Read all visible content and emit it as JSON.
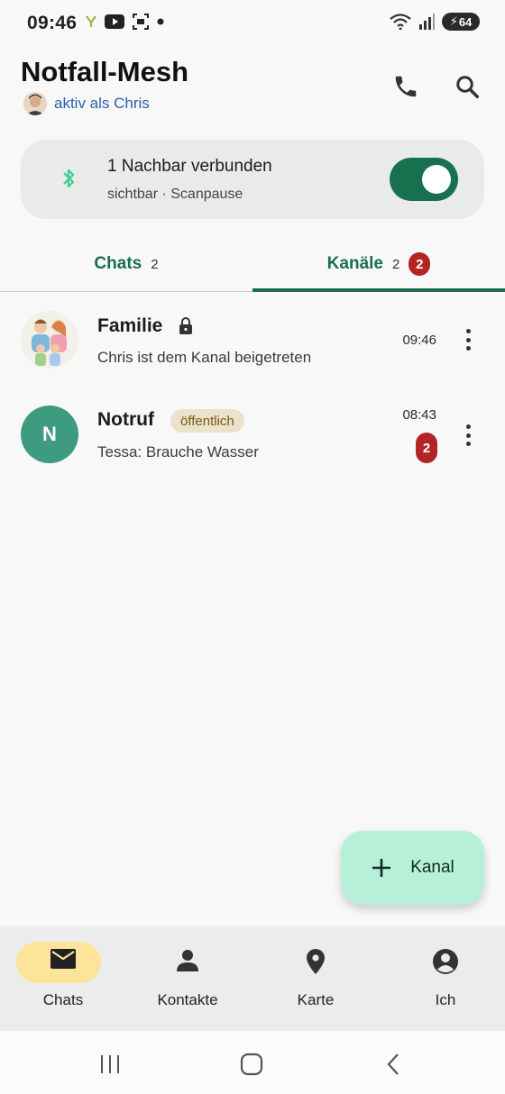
{
  "status_bar": {
    "time": "09:46",
    "battery": "64",
    "icons_left": [
      "vpn-key-icon",
      "youtube-icon",
      "screenshot-icon",
      "dot-icon"
    ],
    "icons_right": [
      "wifi-icon",
      "signal-icon",
      "battery-icon"
    ]
  },
  "header": {
    "title": "Notfall-Mesh",
    "subtitle": "aktiv als Chris",
    "actions": [
      "phone-icon",
      "search-icon"
    ]
  },
  "status_card": {
    "line1": "1 Nachbar verbunden",
    "line2": "sichtbar · Scanpause",
    "toggle_on": true,
    "colors": {
      "toggle": "#17714f",
      "bluetooth": "#3ccf8e"
    }
  },
  "tabs": [
    {
      "label": "Chats",
      "count": "2",
      "badge": "",
      "active": false
    },
    {
      "label": "Kanäle",
      "count": "2",
      "badge": "2",
      "active": true
    }
  ],
  "channels": [
    {
      "name": "Familie",
      "locked": true,
      "badge": "",
      "preview": "Chris ist dem Kanal beigetreten",
      "time": "09:46",
      "unread": ""
    },
    {
      "name": "Notruf",
      "avatar_letter": "N",
      "badge": "öffentlich",
      "preview": "Tessa: Brauche Wasser",
      "time": "08:43",
      "unread": "2"
    }
  ],
  "fab": {
    "label": "Kanal"
  },
  "bottom_nav": [
    {
      "label": "Chats",
      "icon": "mail-icon",
      "active": true
    },
    {
      "label": "Kontakte",
      "icon": "person-icon",
      "active": false
    },
    {
      "label": "Karte",
      "icon": "map-pin-icon",
      "active": false
    },
    {
      "label": "Ich",
      "icon": "account-circle-icon",
      "active": false
    }
  ],
  "colors": {
    "accent": "#1a6e52",
    "badge": "#b52424",
    "active_nav_pill": "#fde49a",
    "fab": "#b7f0d9"
  }
}
